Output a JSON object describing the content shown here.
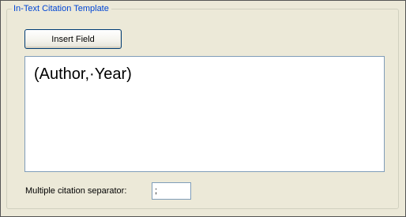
{
  "group": {
    "title": "In-Text Citation Template"
  },
  "insert_field": {
    "label": "Insert Field"
  },
  "template": {
    "value": "(Author,·Year)"
  },
  "separator": {
    "label": "Multiple citation separator:",
    "value": ";"
  },
  "colors": {
    "legend_text": "#0046d5",
    "background": "#ece9d8",
    "input_border": "#7f9db9",
    "button_border": "#003c74"
  }
}
